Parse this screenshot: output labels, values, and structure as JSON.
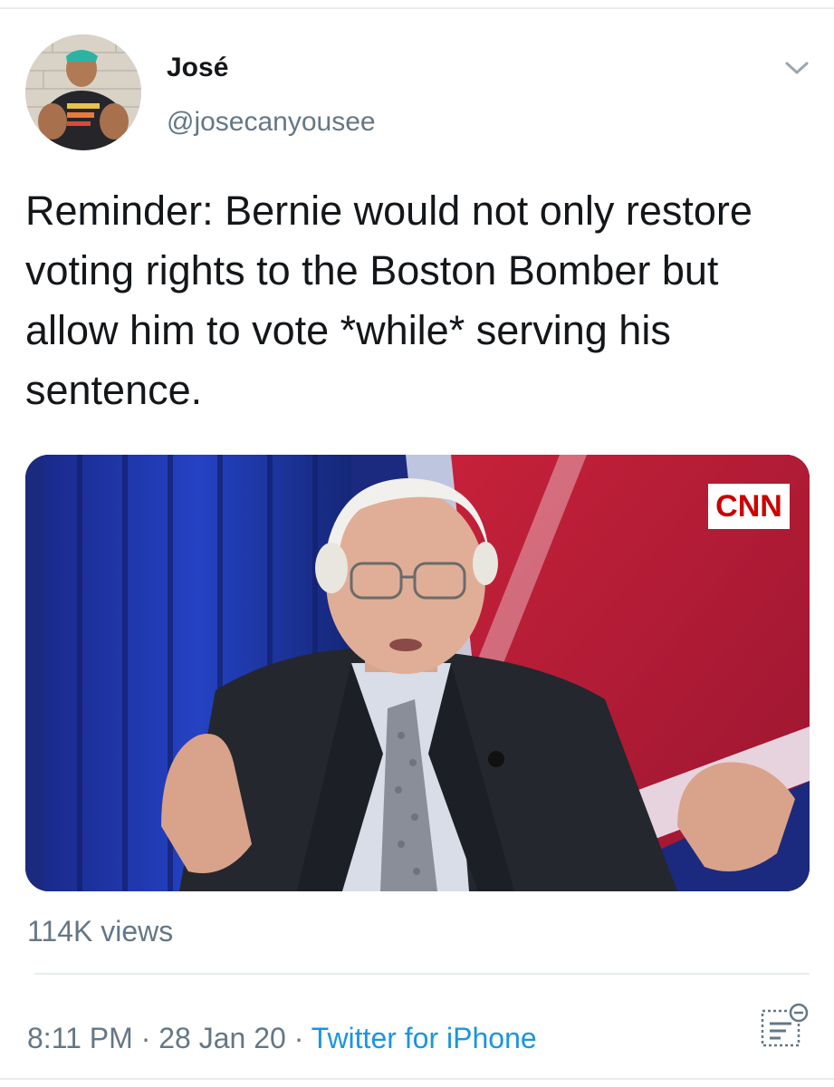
{
  "tweet": {
    "author": {
      "name": "José",
      "handle": "@josecanyousee",
      "avatar_icon": "profile-photo"
    },
    "text": "Reminder: Bernie would not only restore voting rights to the Boston Bomber but allow him to vote *while* serving his sentence.",
    "media": {
      "type": "video",
      "network_logo": "CNN"
    },
    "views": "114K views",
    "meta": {
      "time": "8:11 PM",
      "separator": "·",
      "date": "28 Jan 20",
      "source": "Twitter for iPhone"
    },
    "icons": {
      "more": "chevron-down-icon",
      "analytics": "analytics-icon"
    },
    "colors": {
      "text": "#14171a",
      "secondary": "#657786",
      "link": "#1b95e0",
      "divider": "#e6ecf0"
    }
  }
}
